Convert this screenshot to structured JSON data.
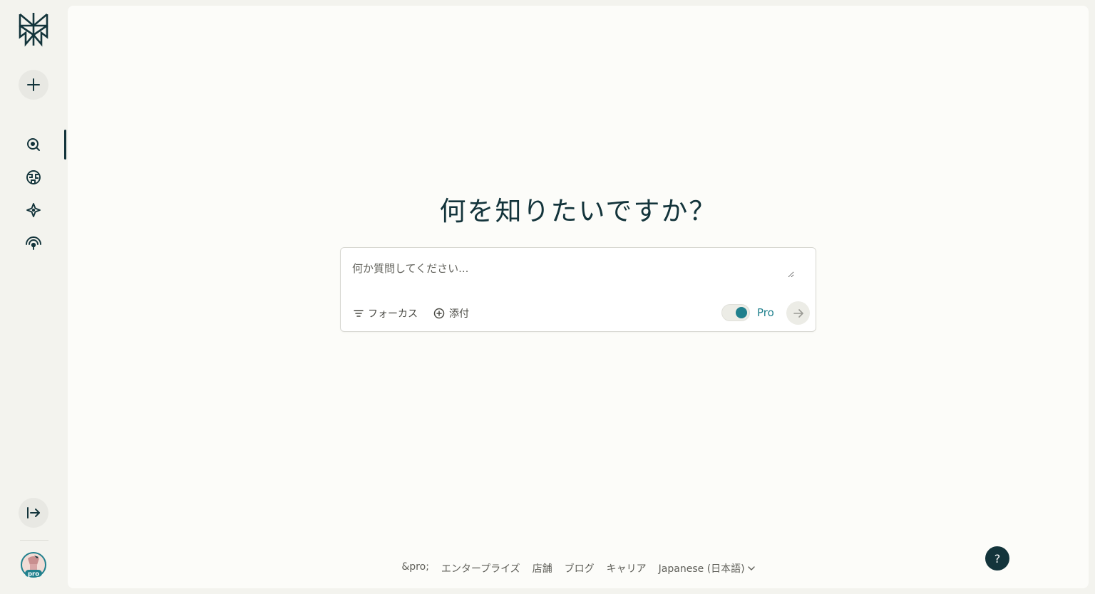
{
  "sidebar": {
    "logo": "perplexity-logo",
    "new_thread_icon": "plus-icon",
    "nav_items": [
      {
        "name": "search",
        "icon": "search-icon",
        "active": true
      },
      {
        "name": "discover",
        "icon": "globe-icon",
        "active": false
      },
      {
        "name": "spaces",
        "icon": "sparkle-icon",
        "active": false
      },
      {
        "name": "library",
        "icon": "signal-icon",
        "active": false
      }
    ],
    "expand_icon": "collapse-right-icon",
    "avatar_badge": "pro"
  },
  "main": {
    "headline": "何を知りたいですか？",
    "search": {
      "placeholder": "何か質問してください...",
      "value": ""
    },
    "toolbar": {
      "focus_label": "フォーカス",
      "attach_label": "添付",
      "pro_label": "Pro",
      "pro_enabled": true
    }
  },
  "footer": {
    "links": [
      "&pro;",
      "エンタープライズ",
      "店舗",
      "ブログ",
      "キャリア"
    ],
    "language": "Japanese (日本語)"
  },
  "help_label": "?",
  "colors": {
    "accent": "#20808d",
    "ink": "#13343b",
    "sidebar_bg": "#f3f3ee",
    "main_bg": "#fcfcf9"
  }
}
